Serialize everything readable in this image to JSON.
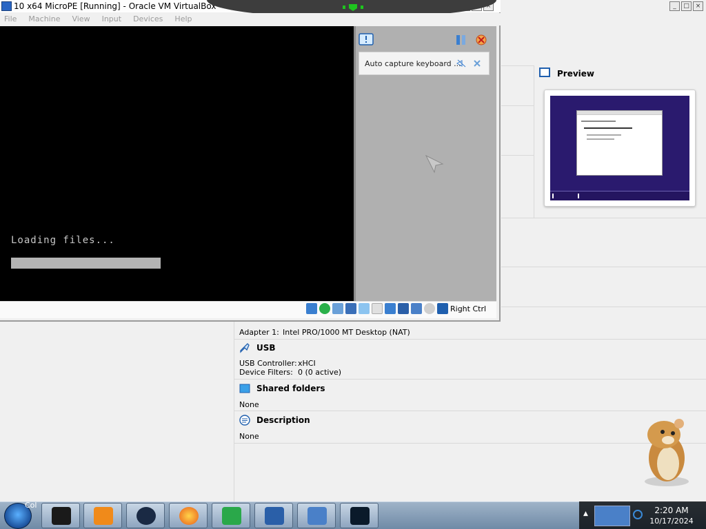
{
  "vm_window": {
    "title": "10 x64 MicroPE [Running] - Oracle VM VirtualBox",
    "menu": [
      "File",
      "Machine",
      "View",
      "Input",
      "Devices",
      "Help"
    ],
    "screen": {
      "loading_text": "Loading files...",
      "progress_bar_color": "#b4b4b4"
    },
    "notification": {
      "text": "Auto capture keyboard ..."
    },
    "status_bar": {
      "host_key": "Right Ctrl"
    }
  },
  "manager": {
    "preview": {
      "title": "Preview"
    },
    "network": {
      "adapter_label": "Adapter 1:",
      "adapter_value": "Intel PRO/1000 MT Desktop (NAT)"
    },
    "usb": {
      "title": "USB",
      "controller_label": "USB Controller:",
      "controller_value": "xHCI",
      "filters_label": "Device Filters:",
      "filters_value": "0 (0 active)"
    },
    "shared_folders": {
      "title": "Shared folders",
      "value": "None"
    },
    "description": {
      "title": "Description",
      "value": "None"
    }
  },
  "taskbar": {
    "start_overlay_text": "Col",
    "items": [
      "terminal-app",
      "media-player-app",
      "dark-globe-app",
      "firefox-app",
      "download-manager-app",
      "virtualbox-app",
      "virtualbox-vm-app",
      "task-monitor-app"
    ],
    "tray": {
      "time": "2:20 AM",
      "date": "10/17/2024"
    }
  },
  "colors": {
    "accent": "#1f5fae",
    "vm_screen": "#000000",
    "taskbar": "#7f98b3"
  }
}
